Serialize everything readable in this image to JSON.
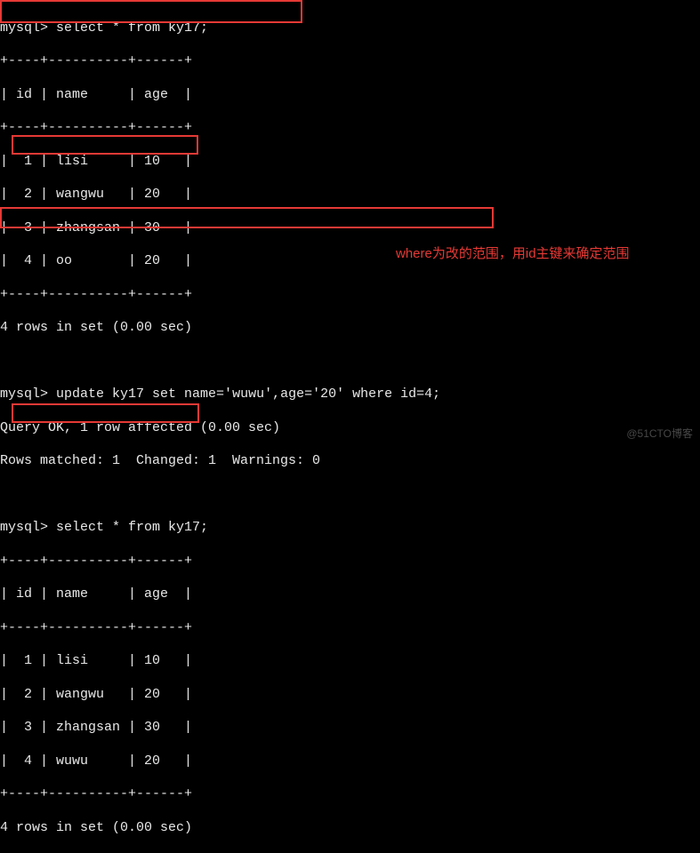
{
  "prompt": "mysql>",
  "queries": {
    "select1": "select * from ky17;",
    "update": "update ky17 set name='wuwu',age='20' where id=4;",
    "select2": "select * from ky17;"
  },
  "table_border_top": "+----+----------+------+",
  "table_border_mid": "+----+----------+------+",
  "table_border_bot": "+----+----------+------+",
  "header_row": "| id | name     | age  |",
  "rows_before": [
    "|  1 | lisi     | 10   |",
    "|  2 | wangwu   | 20   |",
    "|  3 | zhangsan | 30   |",
    "|  4 | oo       | 20   |"
  ],
  "rows_after": [
    "|  1 | lisi     | 10   |",
    "|  2 | wangwu   | 20   |",
    "|  3 | zhangsan | 30   |",
    "|  4 | wuwu     | 20   |"
  ],
  "result_count": "4 rows in set (0.00 sec)",
  "update_ok": "Query OK, 1 row affected (0.00 sec)",
  "update_summary": "Rows matched: 1  Changed: 1  Warnings: 0",
  "annotation": "where为改的范围，用id主键来确定范围",
  "watermark": "@51CTO博客",
  "highlight_color": "#e53935"
}
